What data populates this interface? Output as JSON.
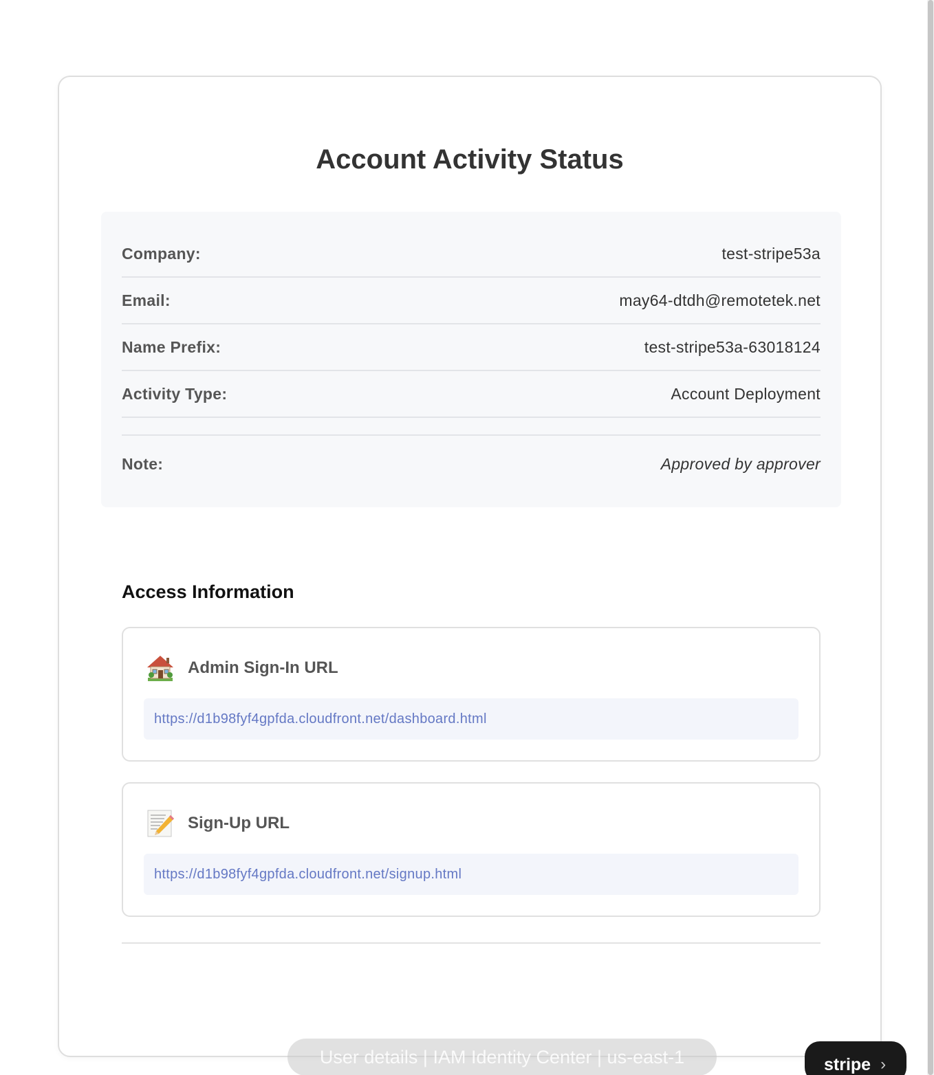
{
  "title": "Account Activity Status",
  "details": [
    {
      "label": "Company:",
      "value": "test-stripe53a"
    },
    {
      "label": "Email:",
      "value": "may64-dtdh@remotetek.net"
    },
    {
      "label": "Name Prefix:",
      "value": "test-stripe53a-63018124"
    },
    {
      "label": "Activity Type:",
      "value": "Account Deployment"
    }
  ],
  "note": {
    "label": "Note:",
    "value": "Approved by approver"
  },
  "access": {
    "title": "Access Information",
    "items": [
      {
        "icon": "house-icon",
        "label": "Admin Sign-In URL",
        "url": "https://d1b98fyf4gpfda.cloudfront.net/dashboard.html"
      },
      {
        "icon": "memo-icon",
        "label": "Sign-Up URL",
        "url": "https://d1b98fyf4gpfda.cloudfront.net/signup.html"
      }
    ]
  },
  "tooltip": "User details | IAM Identity Center | us-east-1",
  "stripe_badge": {
    "label": "stripe",
    "chevron": "›"
  }
}
